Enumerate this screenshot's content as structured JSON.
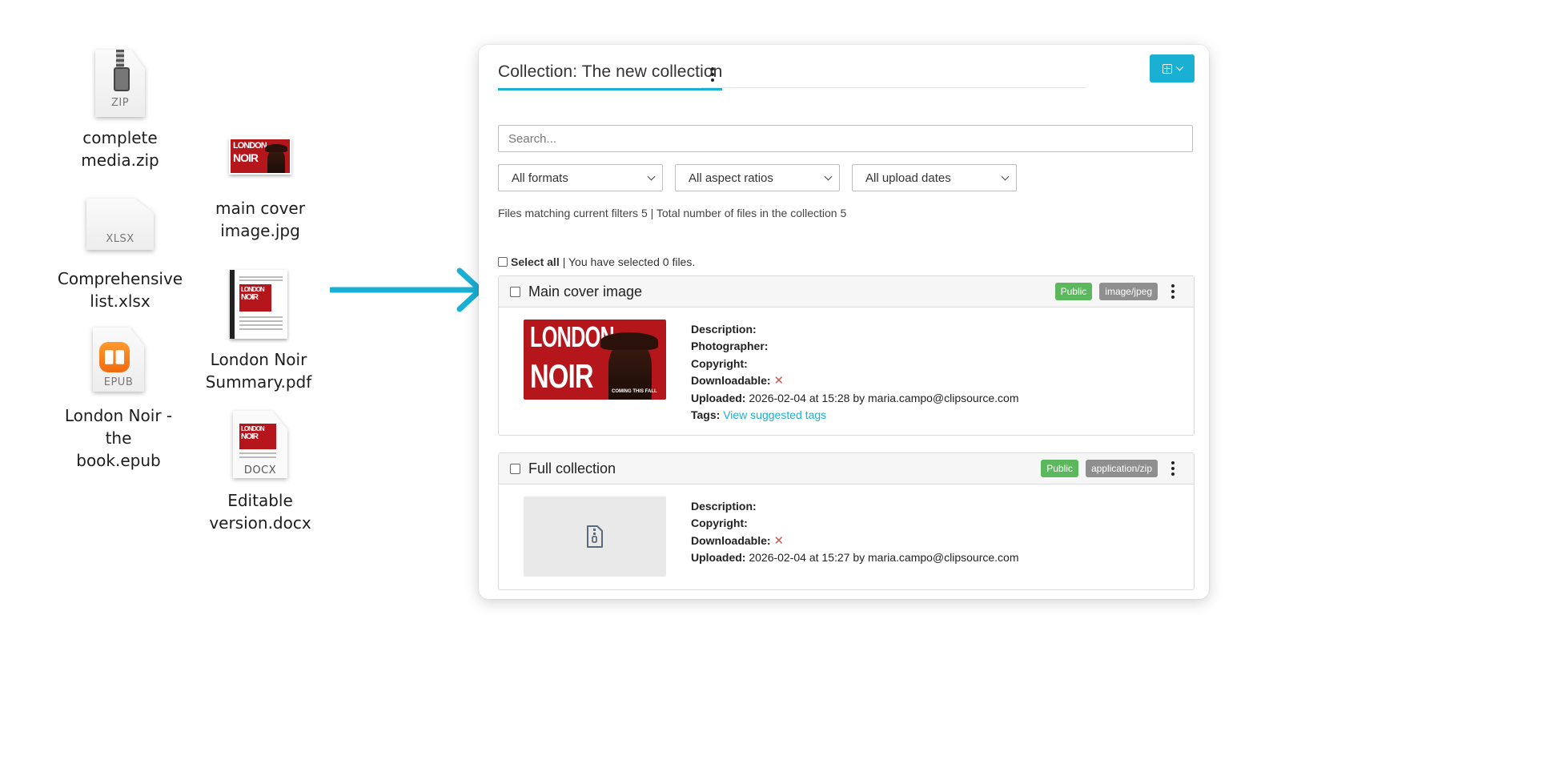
{
  "desktop": {
    "files": [
      {
        "name": "complete\nmedia.zip",
        "ext": "ZIP"
      },
      {
        "name": "Comprehensive\nlist.xlsx",
        "ext": "XLSX"
      },
      {
        "name": "London Noir - the\nbook.epub",
        "ext": "EPUB"
      },
      {
        "name": "main cover\nimage.jpg"
      },
      {
        "name": "London Noir\nSummary.pdf"
      },
      {
        "name": "Editable\nversion.docx",
        "ext": "DOCX"
      }
    ],
    "poster_text": {
      "line1": "LONDON",
      "line2": "NOIR",
      "tagline": "COMING THIS FALL"
    }
  },
  "arrow_color": "#1ab0d4",
  "panel": {
    "title": "Collection: The new collection",
    "search_placeholder": "Search...",
    "filters": [
      "All formats",
      "All aspect ratios",
      "All upload dates"
    ],
    "counts_text": "Files matching current filters 5 | Total number of files in the collection 5",
    "select_all_label": "Select all",
    "selected_text": "| You have selected 0 files.",
    "accent_color": "#1ab0d4",
    "items": [
      {
        "title": "Main cover image",
        "visibility": "Public",
        "mime": "image/jpeg",
        "labels": {
          "description": "Description:",
          "photographer": "Photographer:",
          "copyright": "Copyright:",
          "downloadable": "Downloadable:",
          "uploaded": "Uploaded:",
          "tags": "Tags:"
        },
        "downloadable_mark": "✕",
        "uploaded": "2026-02-04 at 15:28 by maria.campo@clipsource.com",
        "tags_link": "View suggested tags"
      },
      {
        "title": "Full collection",
        "visibility": "Public",
        "mime": "application/zip",
        "labels": {
          "description": "Description:",
          "copyright": "Copyright:",
          "downloadable": "Downloadable:",
          "uploaded": "Uploaded:"
        },
        "downloadable_mark": "✕",
        "uploaded": "2026-02-04 at 15:27 by maria.campo@clipsource.com"
      }
    ]
  }
}
